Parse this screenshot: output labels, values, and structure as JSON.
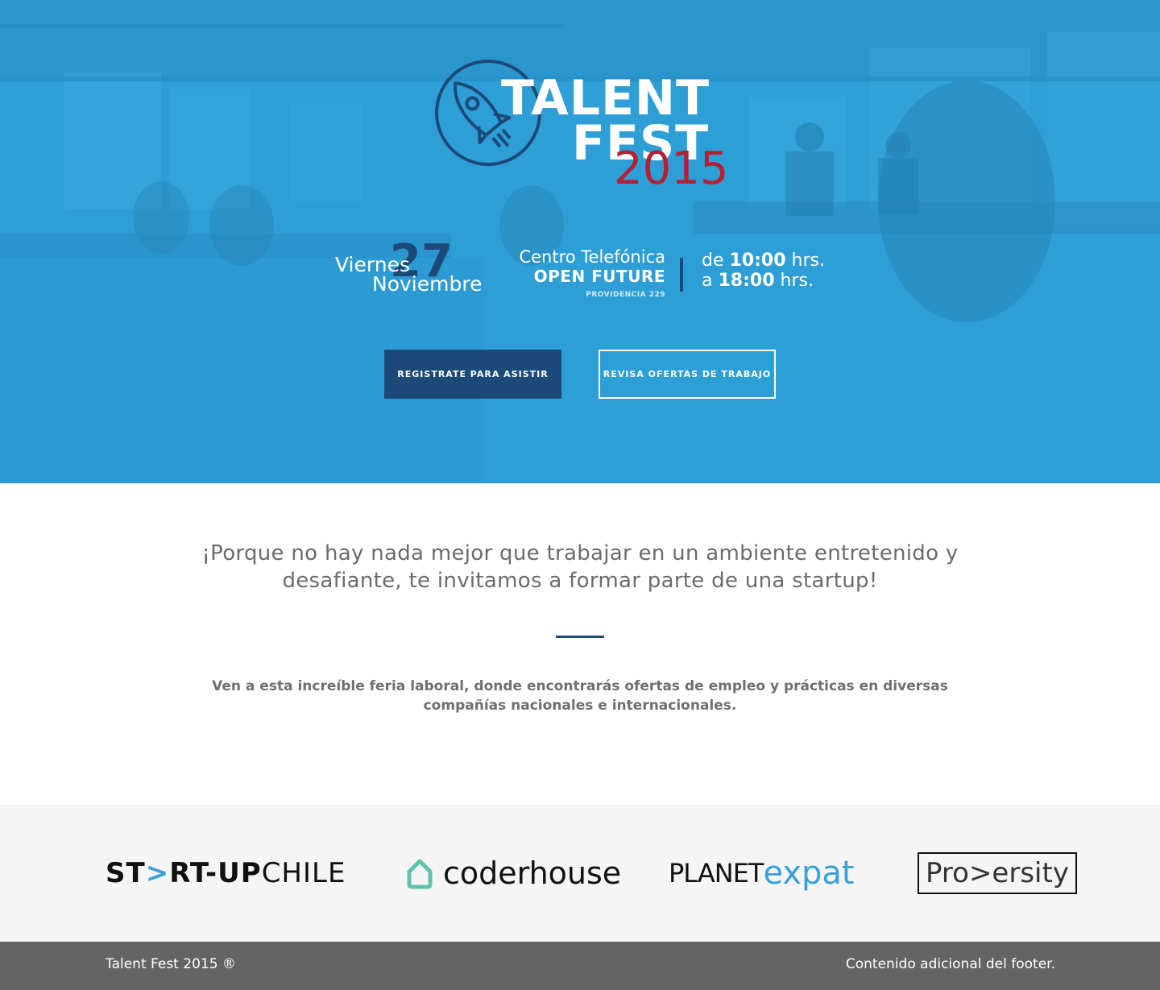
{
  "hero": {
    "logo": {
      "line1": "TALENT",
      "line2": "FEST",
      "year": "2015"
    },
    "event": {
      "day_number": "27",
      "day_name": "Viernes",
      "month": "Noviembre",
      "venue_name": "Centro Telefónica",
      "venue_sub": "OPEN FUTURE",
      "venue_address": "PROVIDENCIA 229",
      "hours_from_prefix": "de ",
      "hours_from": "10:00",
      "hours_from_suffix": " hrs.",
      "hours_to_prefix": "a ",
      "hours_to": "18:00",
      "hours_to_suffix": " hrs."
    },
    "buttons": {
      "register": "REGISTRATE PARA ASISTIR",
      "jobs": "REVISA OFERTAS DE TRABAJO"
    }
  },
  "intro": {
    "lead": "¡Porque no hay nada mejor que trabajar en un ambiente entretenido y desafiante, te invitamos a formar parte de una startup!",
    "body": "Ven a esta increíble feria laboral, donde encontrarás ofertas de empleo y prácticas en diversas compañías nacionales e internacionales."
  },
  "sponsors": {
    "startup": {
      "a": "ST",
      "arrow": ">",
      "b": "RT-UP",
      "c": "CHILE"
    },
    "coderhouse": "coderhouse",
    "planet": {
      "a": "PLANET",
      "b": "expat"
    },
    "proversity": "Pro>ersity"
  },
  "footer": {
    "left": "Talent Fest 2015 ®",
    "right": "Contenido adicional del footer."
  },
  "colors": {
    "hero_blue": "#2d9fd6",
    "navy": "#1c4a78",
    "red": "#b52035",
    "footer_gray": "#646464"
  }
}
